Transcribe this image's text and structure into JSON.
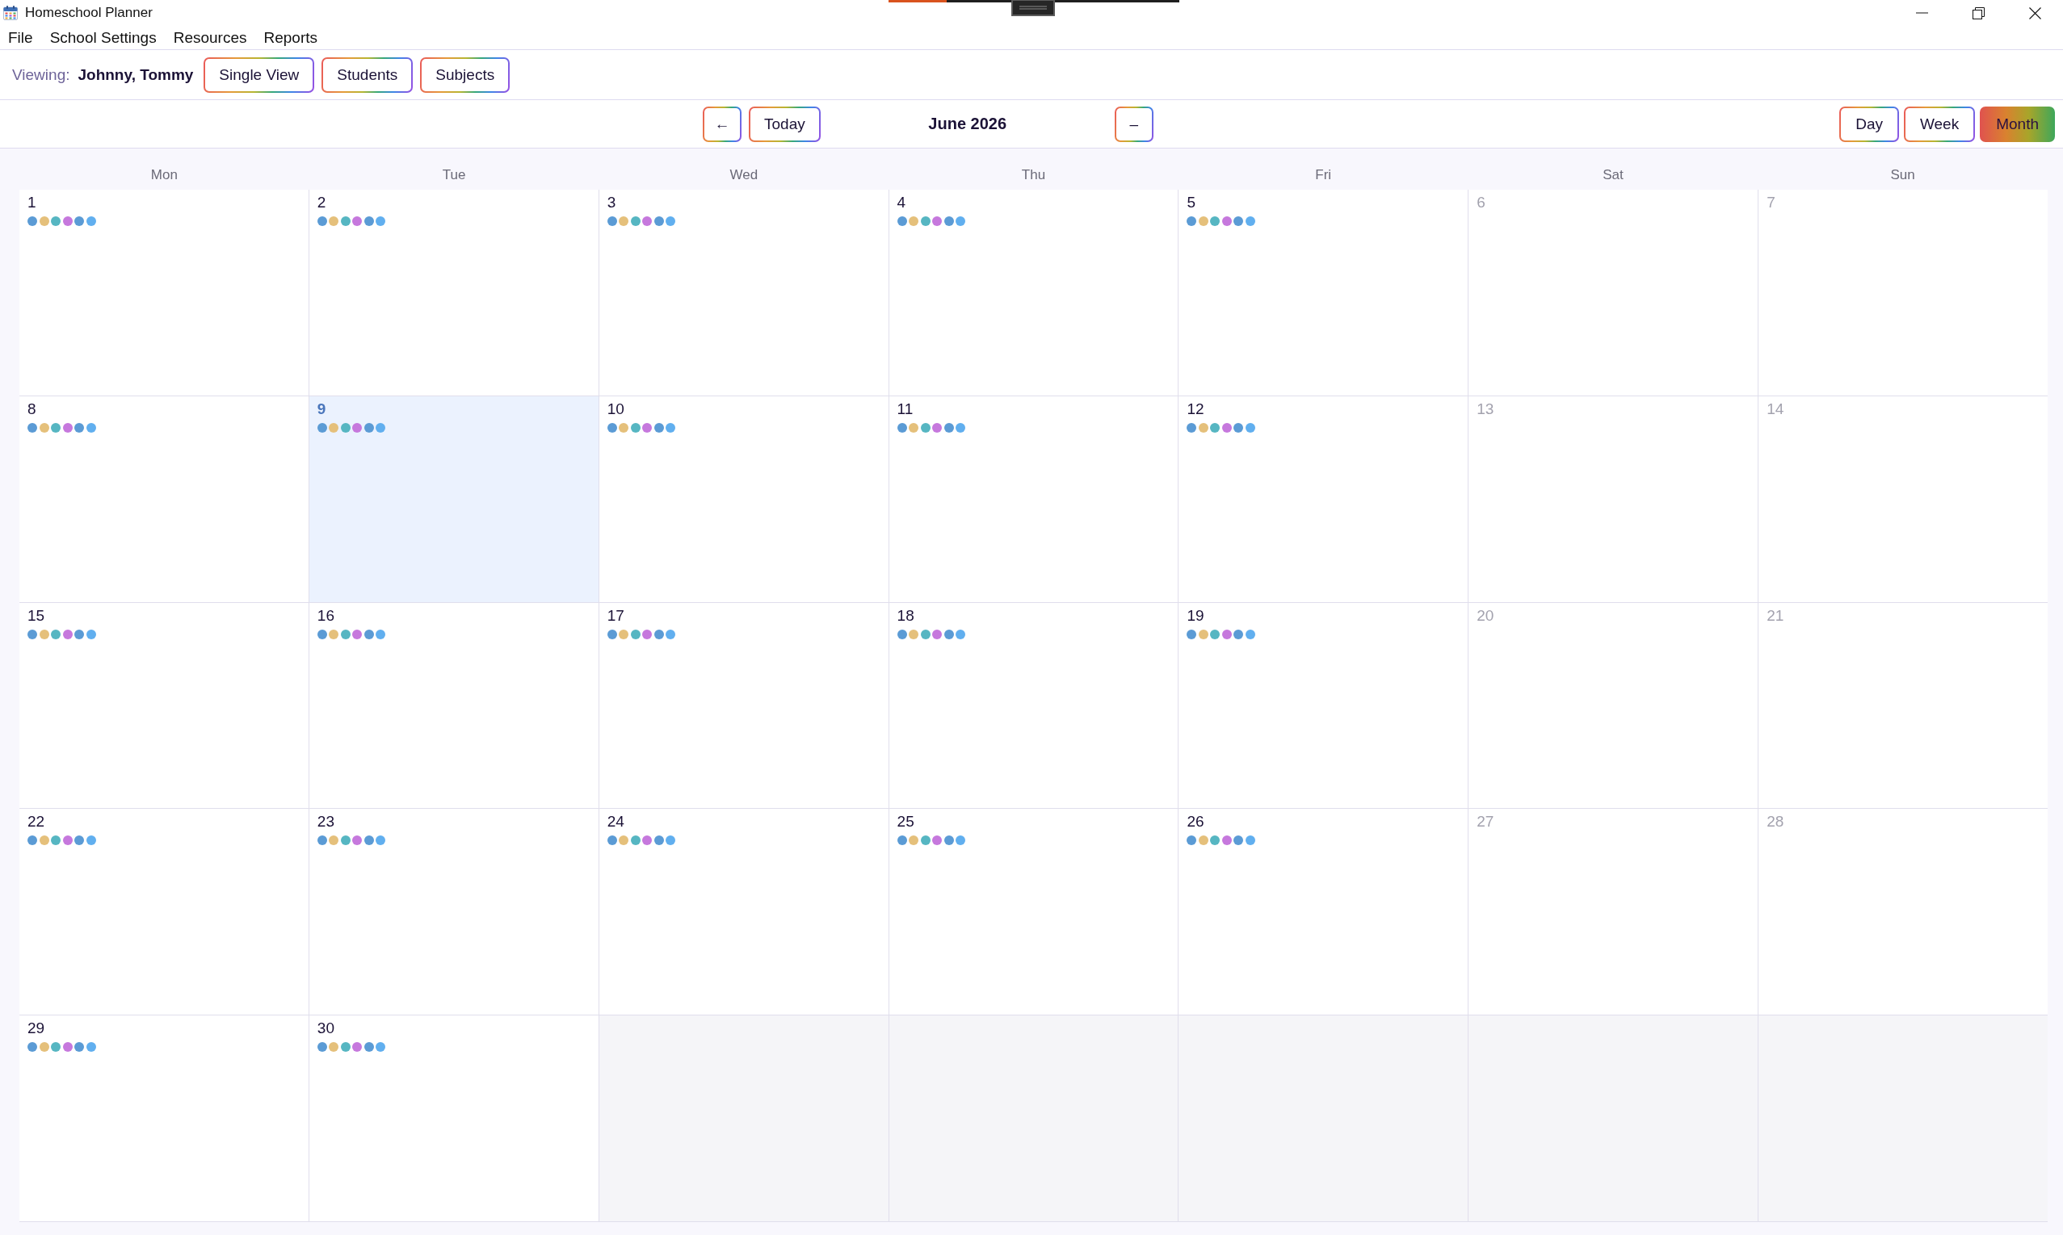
{
  "window": {
    "title": "Homeschool Planner"
  },
  "menu": [
    "File",
    "School Settings",
    "Resources",
    "Reports"
  ],
  "viewing": {
    "label": "Viewing:",
    "value": "Johnny, Tommy",
    "buttons": [
      "Single View",
      "Students",
      "Subjects"
    ]
  },
  "navigation": {
    "prev": "←",
    "today": "Today",
    "title": "June 2026",
    "next": "–"
  },
  "view_modes": [
    {
      "label": "Day",
      "selected": false
    },
    {
      "label": "Week",
      "selected": false
    },
    {
      "label": "Month",
      "selected": true
    }
  ],
  "calendar": {
    "weekdays": [
      "Mon",
      "Tue",
      "Wed",
      "Thu",
      "Fri",
      "Sat",
      "Sun"
    ],
    "cells": [
      {
        "kind": "day",
        "day": "1",
        "weekend": false,
        "today": false,
        "dots": [
          {
            "color": "#5b9bd5"
          },
          {
            "color": "#e5c07b"
          },
          {
            "color": "#56b6c2"
          },
          {
            "color": "#c678dd"
          },
          {
            "color": "#5b9bd5"
          },
          {
            "color": "#61afef"
          }
        ]
      },
      {
        "kind": "day",
        "day": "2",
        "weekend": false,
        "today": false,
        "dots": [
          {
            "color": "#5b9bd5"
          },
          {
            "color": "#e5c07b"
          },
          {
            "color": "#56b6c2"
          },
          {
            "color": "#c678dd"
          },
          {
            "color": "#5b9bd5"
          },
          {
            "color": "#61afef"
          }
        ]
      },
      {
        "kind": "day",
        "day": "3",
        "weekend": false,
        "today": false,
        "dots": [
          {
            "color": "#5b9bd5"
          },
          {
            "color": "#e5c07b"
          },
          {
            "color": "#56b6c2"
          },
          {
            "color": "#c678dd"
          },
          {
            "color": "#5b9bd5"
          },
          {
            "color": "#61afef"
          }
        ]
      },
      {
        "kind": "day",
        "day": "4",
        "weekend": false,
        "today": false,
        "dots": [
          {
            "color": "#5b9bd5"
          },
          {
            "color": "#e5c07b"
          },
          {
            "color": "#56b6c2"
          },
          {
            "color": "#c678dd"
          },
          {
            "color": "#5b9bd5"
          },
          {
            "color": "#61afef"
          }
        ]
      },
      {
        "kind": "day",
        "day": "5",
        "weekend": false,
        "today": false,
        "dots": [
          {
            "color": "#5b9bd5"
          },
          {
            "color": "#e5c07b"
          },
          {
            "color": "#56b6c2"
          },
          {
            "color": "#c678dd"
          },
          {
            "color": "#5b9bd5"
          },
          {
            "color": "#61afef"
          }
        ]
      },
      {
        "kind": "day",
        "day": "6",
        "weekend": true,
        "today": false
      },
      {
        "kind": "day",
        "day": "7",
        "weekend": true,
        "today": false
      },
      {
        "kind": "day",
        "day": "8",
        "weekend": false,
        "today": false,
        "dots": [
          {
            "color": "#5b9bd5"
          },
          {
            "color": "#e5c07b"
          },
          {
            "color": "#56b6c2"
          },
          {
            "color": "#c678dd"
          },
          {
            "color": "#5b9bd5"
          },
          {
            "color": "#61afef"
          }
        ]
      },
      {
        "kind": "day",
        "day": "9",
        "weekend": false,
        "today": true,
        "dots": [
          {
            "color": "#5b9bd5"
          },
          {
            "color": "#e5c07b"
          },
          {
            "color": "#56b6c2"
          },
          {
            "color": "#c678dd"
          },
          {
            "color": "#5b9bd5"
          },
          {
            "color": "#61afef"
          }
        ]
      },
      {
        "kind": "day",
        "day": "10",
        "weekend": false,
        "today": false,
        "dots": [
          {
            "color": "#5b9bd5"
          },
          {
            "color": "#e5c07b"
          },
          {
            "color": "#56b6c2"
          },
          {
            "color": "#c678dd"
          },
          {
            "color": "#5b9bd5"
          },
          {
            "color": "#61afef"
          }
        ]
      },
      {
        "kind": "day",
        "day": "11",
        "weekend": false,
        "today": false,
        "dots": [
          {
            "color": "#5b9bd5"
          },
          {
            "color": "#e5c07b"
          },
          {
            "color": "#56b6c2"
          },
          {
            "color": "#c678dd"
          },
          {
            "color": "#5b9bd5"
          },
          {
            "color": "#61afef"
          }
        ]
      },
      {
        "kind": "day",
        "day": "12",
        "weekend": false,
        "today": false,
        "dots": [
          {
            "color": "#5b9bd5"
          },
          {
            "color": "#e5c07b"
          },
          {
            "color": "#56b6c2"
          },
          {
            "color": "#c678dd"
          },
          {
            "color": "#5b9bd5"
          },
          {
            "color": "#61afef"
          }
        ]
      },
      {
        "kind": "day",
        "day": "13",
        "weekend": true,
        "today": false
      },
      {
        "kind": "day",
        "day": "14",
        "weekend": true,
        "today": false
      },
      {
        "kind": "day",
        "day": "15",
        "weekend": false,
        "today": false,
        "dots": [
          {
            "color": "#5b9bd5"
          },
          {
            "color": "#e5c07b"
          },
          {
            "color": "#56b6c2"
          },
          {
            "color": "#c678dd"
          },
          {
            "color": "#5b9bd5"
          },
          {
            "color": "#61afef"
          }
        ]
      },
      {
        "kind": "day",
        "day": "16",
        "weekend": false,
        "today": false,
        "dots": [
          {
            "color": "#5b9bd5"
          },
          {
            "color": "#e5c07b"
          },
          {
            "color": "#56b6c2"
          },
          {
            "color": "#c678dd"
          },
          {
            "color": "#5b9bd5"
          },
          {
            "color": "#61afef"
          }
        ]
      },
      {
        "kind": "day",
        "day": "17",
        "weekend": false,
        "today": false,
        "dots": [
          {
            "color": "#5b9bd5"
          },
          {
            "color": "#e5c07b"
          },
          {
            "color": "#56b6c2"
          },
          {
            "color": "#c678dd"
          },
          {
            "color": "#5b9bd5"
          },
          {
            "color": "#61afef"
          }
        ]
      },
      {
        "kind": "day",
        "day": "18",
        "weekend": false,
        "today": false,
        "dots": [
          {
            "color": "#5b9bd5"
          },
          {
            "color": "#e5c07b"
          },
          {
            "color": "#56b6c2"
          },
          {
            "color": "#c678dd"
          },
          {
            "color": "#5b9bd5"
          },
          {
            "color": "#61afef"
          }
        ]
      },
      {
        "kind": "day",
        "day": "19",
        "weekend": false,
        "today": false,
        "dots": [
          {
            "color": "#5b9bd5"
          },
          {
            "color": "#e5c07b"
          },
          {
            "color": "#56b6c2"
          },
          {
            "color": "#c678dd"
          },
          {
            "color": "#5b9bd5"
          },
          {
            "color": "#61afef"
          }
        ]
      },
      {
        "kind": "day",
        "day": "20",
        "weekend": true,
        "today": false
      },
      {
        "kind": "day",
        "day": "21",
        "weekend": true,
        "today": false
      },
      {
        "kind": "day",
        "day": "22",
        "weekend": false,
        "today": false,
        "dots": [
          {
            "color": "#5b9bd5"
          },
          {
            "color": "#e5c07b"
          },
          {
            "color": "#56b6c2"
          },
          {
            "color": "#c678dd"
          },
          {
            "color": "#5b9bd5"
          },
          {
            "color": "#61afef"
          }
        ]
      },
      {
        "kind": "day",
        "day": "23",
        "weekend": false,
        "today": false,
        "dots": [
          {
            "color": "#5b9bd5"
          },
          {
            "color": "#e5c07b"
          },
          {
            "color": "#56b6c2"
          },
          {
            "color": "#c678dd"
          },
          {
            "color": "#5b9bd5"
          },
          {
            "color": "#61afef"
          }
        ]
      },
      {
        "kind": "day",
        "day": "24",
        "weekend": false,
        "today": false,
        "dots": [
          {
            "color": "#5b9bd5"
          },
          {
            "color": "#e5c07b"
          },
          {
            "color": "#56b6c2"
          },
          {
            "color": "#c678dd"
          },
          {
            "color": "#5b9bd5"
          },
          {
            "color": "#61afef"
          }
        ]
      },
      {
        "kind": "day",
        "day": "25",
        "weekend": false,
        "today": false,
        "dots": [
          {
            "color": "#5b9bd5"
          },
          {
            "color": "#e5c07b"
          },
          {
            "color": "#56b6c2"
          },
          {
            "color": "#c678dd"
          },
          {
            "color": "#5b9bd5"
          },
          {
            "color": "#61afef"
          }
        ]
      },
      {
        "kind": "day",
        "day": "26",
        "weekend": false,
        "today": false,
        "dots": [
          {
            "color": "#5b9bd5"
          },
          {
            "color": "#e5c07b"
          },
          {
            "color": "#56b6c2"
          },
          {
            "color": "#c678dd"
          },
          {
            "color": "#5b9bd5"
          },
          {
            "color": "#61afef"
          }
        ]
      },
      {
        "kind": "day",
        "day": "27",
        "weekend": true,
        "today": false
      },
      {
        "kind": "day",
        "day": "28",
        "weekend": true,
        "today": false
      },
      {
        "kind": "day",
        "day": "29",
        "weekend": false,
        "today": false,
        "dots": [
          {
            "color": "#5b9bd5"
          },
          {
            "color": "#e5c07b"
          },
          {
            "color": "#56b6c2"
          },
          {
            "color": "#c678dd"
          },
          {
            "color": "#5b9bd5"
          },
          {
            "color": "#61afef"
          }
        ]
      },
      {
        "kind": "day",
        "day": "30",
        "weekend": false,
        "today": false,
        "dots": [
          {
            "color": "#5b9bd5"
          },
          {
            "color": "#e5c07b"
          },
          {
            "color": "#56b6c2"
          },
          {
            "color": "#c678dd"
          },
          {
            "color": "#5b9bd5"
          },
          {
            "color": "#61afef"
          }
        ]
      },
      {
        "kind": "blank"
      },
      {
        "kind": "blank"
      },
      {
        "kind": "blank"
      },
      {
        "kind": "blank"
      },
      {
        "kind": "blank"
      }
    ]
  }
}
